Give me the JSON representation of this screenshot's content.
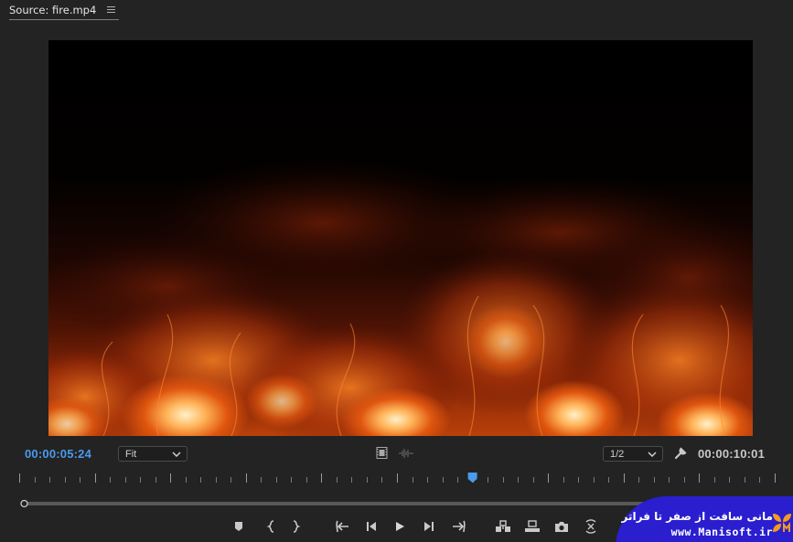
{
  "panel": {
    "tab_title": "Source: fire.mp4"
  },
  "viewer": {
    "content": "fire video frame"
  },
  "controls": {
    "current_timecode": "00:00:05:24",
    "duration_timecode": "00:00:10:01",
    "zoom_select": {
      "value": "Fit"
    },
    "resolution_select": {
      "value": "1/2"
    },
    "playhead_position_fraction": 0.6
  },
  "colors": {
    "accent": "#4a9aed",
    "background": "#232323",
    "watermark_bg": "#2a1ecf"
  },
  "transport": {
    "buttons": [
      "add-marker",
      "mark-in",
      "mark-out",
      "go-to-in",
      "step-back",
      "play",
      "step-forward",
      "go-to-out",
      "insert",
      "overwrite",
      "export-frame",
      "button-editor"
    ]
  },
  "watermark": {
    "line1": "مانی سافت از صفر تا فراتر",
    "line2": "www.Manisoft.ir"
  }
}
